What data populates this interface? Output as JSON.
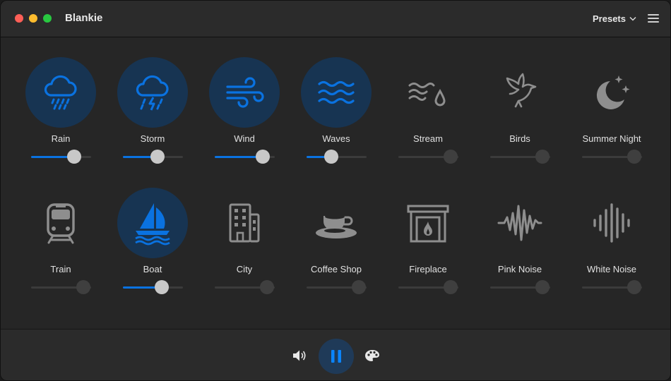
{
  "window": {
    "title": "Blankie"
  },
  "titlebar": {
    "presets_label": "Presets"
  },
  "colors": {
    "accent": "#0a72e0",
    "active_circle": "#173452",
    "idle_icon": "#8e8e8e"
  },
  "sounds": [
    {
      "label": "Rain",
      "icon": "cloud-rain-icon",
      "active": true,
      "volume": 0.72
    },
    {
      "label": "Storm",
      "icon": "cloud-bolt-rain-icon",
      "active": true,
      "volume": 0.58
    },
    {
      "label": "Wind",
      "icon": "wind-icon",
      "active": true,
      "volume": 0.8
    },
    {
      "label": "Waves",
      "icon": "water-waves-icon",
      "active": true,
      "volume": 0.41
    },
    {
      "label": "Stream",
      "icon": "water-drop-waves-icon",
      "active": false,
      "volume": 0.87
    },
    {
      "label": "Birds",
      "icon": "bird-icon",
      "active": false,
      "volume": 0.87
    },
    {
      "label": "Summer Night",
      "icon": "moon-stars-icon",
      "active": false,
      "volume": 0.87
    },
    {
      "label": "Train",
      "icon": "tram-icon",
      "active": false,
      "volume": 0.87
    },
    {
      "label": "Boat",
      "icon": "sailboat-icon",
      "active": true,
      "volume": 0.65
    },
    {
      "label": "City",
      "icon": "building-icon",
      "active": false,
      "volume": 0.87
    },
    {
      "label": "Coffee Shop",
      "icon": "cup-saucer-icon",
      "active": false,
      "volume": 0.87
    },
    {
      "label": "Fireplace",
      "icon": "fireplace-icon",
      "active": false,
      "volume": 0.87
    },
    {
      "label": "Pink Noise",
      "icon": "waveform-path-icon",
      "active": false,
      "volume": 0.87
    },
    {
      "label": "White Noise",
      "icon": "waveform-icon",
      "active": false,
      "volume": 0.87
    }
  ],
  "controls": {
    "volume_icon": "speaker-wave-icon",
    "play_state": "playing",
    "pause_icon": "pause-icon",
    "theme_icon": "palette-icon"
  }
}
